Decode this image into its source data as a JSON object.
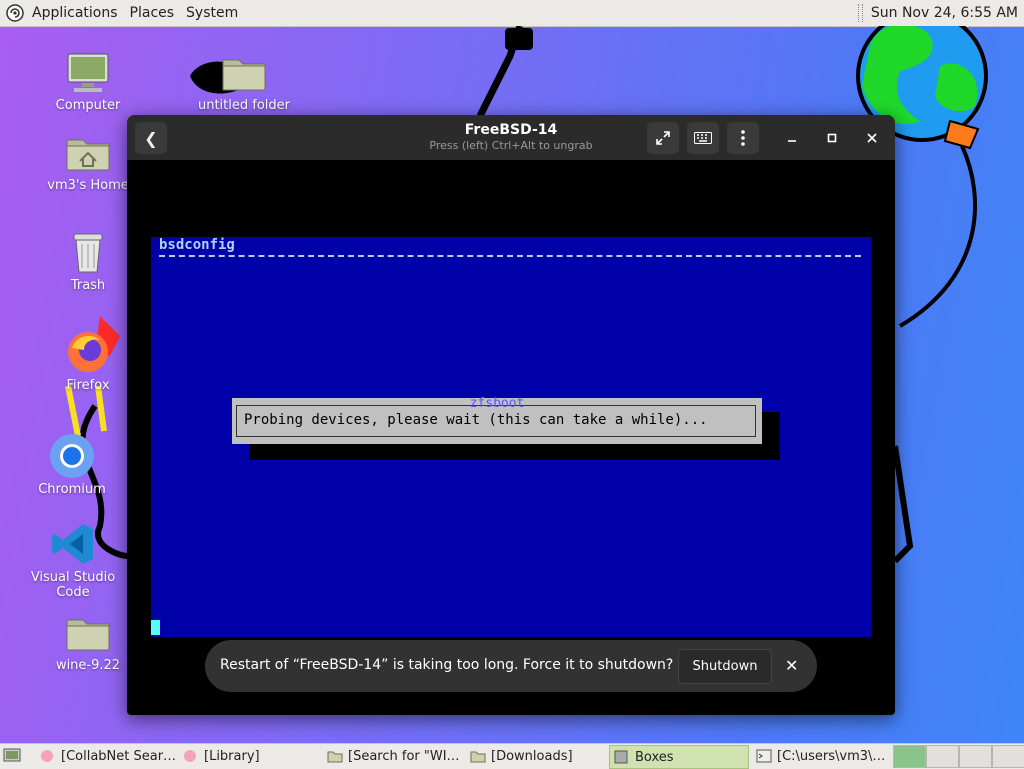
{
  "top_panel": {
    "menus": [
      "Applications",
      "Places",
      "System"
    ],
    "clock": "Sun Nov 24,  6:55 AM"
  },
  "desktop": {
    "icons": [
      {
        "label": "Computer",
        "icon": "computer-icon"
      },
      {
        "label": "untitled folder",
        "icon": "folder-icon"
      },
      {
        "label": "vm3's Home",
        "icon": "home-folder-icon"
      },
      {
        "label": "Trash",
        "icon": "trash-icon"
      },
      {
        "label": "Firefox",
        "icon": "firefox-icon"
      },
      {
        "label": "Chromium",
        "icon": "chromium-icon"
      },
      {
        "label": "Visual Studio Code",
        "icon": "vscode-icon"
      },
      {
        "label": "wine-9.22",
        "icon": "folder-icon"
      }
    ]
  },
  "window": {
    "title": "FreeBSD-14",
    "subtitle": "Press (left) Ctrl+Alt to ungrab",
    "back_icon": "back-icon",
    "fullscreen_icon": "fullscreen-icon",
    "keyboard_icon": "keyboard-icon",
    "menu_icon": "kebab-menu-icon"
  },
  "vm": {
    "header": "bsdconfig",
    "dialog_title": "zfsboot",
    "dialog_message": "Probing devices, please wait (this can take a while)...",
    "colors": {
      "background": "#0000a8",
      "dialog": "#c0c0c0",
      "text": "#aad4ff"
    }
  },
  "toast": {
    "message": "Restart of “FreeBSD-14” is taking too long. Force it to shutdown?",
    "button": "Shutdown",
    "close": "✕"
  },
  "taskbar": {
    "tasks": [
      {
        "label": "[CollabNet Sear…",
        "icon": "browser-icon"
      },
      {
        "label": "[Library]",
        "icon": "browser-icon"
      },
      {
        "label": "[Search for \"WI…",
        "icon": "folder-icon"
      },
      {
        "label": "[Downloads]",
        "icon": "folder-icon"
      },
      {
        "label": "Boxes",
        "icon": "boxes-icon",
        "active": true
      },
      {
        "label": "[C:\\users\\vm3\\…",
        "icon": "terminal-icon"
      }
    ]
  }
}
